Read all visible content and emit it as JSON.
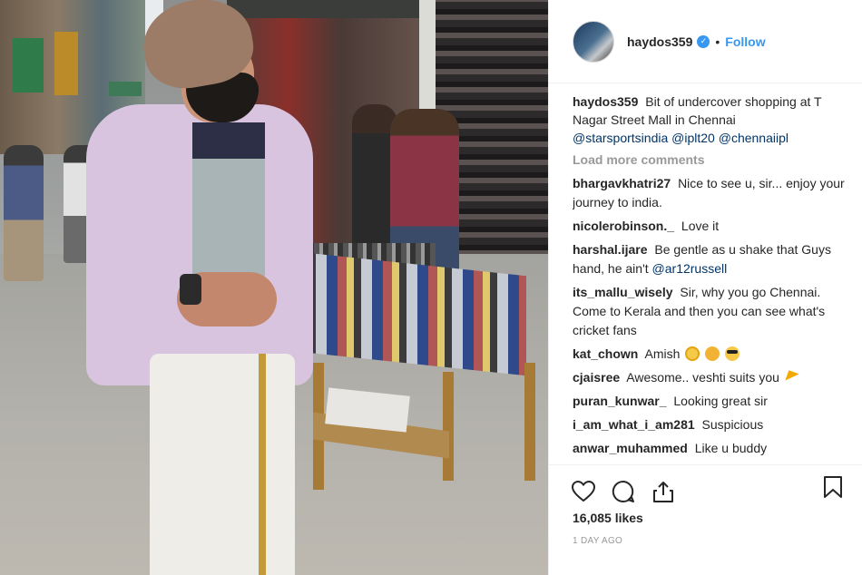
{
  "post": {
    "username": "haydos359",
    "separator": "•",
    "follow_label": "Follow",
    "caption_text": "Bit of undercover shopping at T Nagar Street Mall in Chennai",
    "caption_tags": [
      "@starsportsindia",
      "@iplt20",
      "@chennaiipl"
    ],
    "likes": "16,085 likes",
    "time": "1 DAY AGO"
  },
  "comments": {
    "load_more": "Load more comments",
    "items": [
      {
        "user": "bhargavkhatri27",
        "text": "Nice to see u, sir... enjoy your journey to india."
      },
      {
        "user": "nicolerobinson._",
        "text": "Love it"
      },
      {
        "user": "harshal.ijare",
        "text": "Be gentle as u shake that Guys hand, he ain't",
        "mention": "@ar12russell"
      },
      {
        "user": "its_mallu_wisely",
        "text": "Sir, why you go Chennai. Come to Kerala and then you can see what's cricket fans"
      },
      {
        "user": "kat_chown",
        "text": "Amish"
      },
      {
        "user": "cjaisree",
        "text": "Awesome.. veshti suits you"
      },
      {
        "user": "puran_kunwar_",
        "text": "Looking great sir"
      },
      {
        "user": "i_am_what_i_am281",
        "text": "Suspicious"
      },
      {
        "user": "anwar_muhammed",
        "text": "Like u buddy"
      }
    ]
  },
  "icons": [
    "heart-icon",
    "comment-icon",
    "share-icon",
    "bookmark-icon",
    "verified-badge-icon"
  ],
  "colors": {
    "link": "#3897f0",
    "tag": "#003569",
    "muted": "#999999",
    "text": "#262626"
  }
}
